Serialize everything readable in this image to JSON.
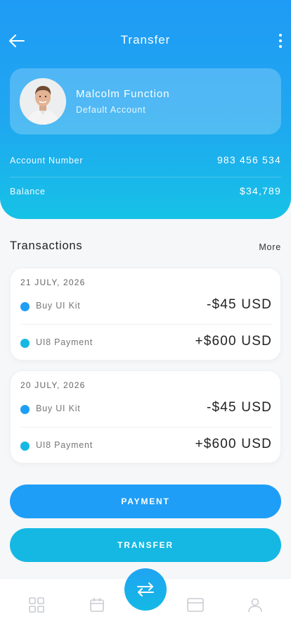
{
  "header": {
    "title": "Transfer",
    "back_icon": "arrow-left-icon",
    "menu_icon": "more-vertical-icon"
  },
  "account": {
    "name": "Malcolm Function",
    "type": "Default Account",
    "number_label": "Account Number",
    "number_value": "983 456 534",
    "balance_label": "Balance",
    "balance_value": "$34,789"
  },
  "transactions": {
    "title": "Transactions",
    "more_label": "More",
    "groups": [
      {
        "date": "21 JULY, 2026",
        "items": [
          {
            "name": "Buy UI Kit",
            "amount": "-$45 USD",
            "dot_color": "#1f9ef7"
          },
          {
            "name": "UI8 Payment",
            "amount": "+$600 USD",
            "dot_color": "#15b8e3"
          }
        ]
      },
      {
        "date": "20 JULY, 2026",
        "items": [
          {
            "name": "Buy UI Kit",
            "amount": "-$45 USD",
            "dot_color": "#1f9ef7"
          },
          {
            "name": "UI8 Payment",
            "amount": "+$600 USD",
            "dot_color": "#15b8e3"
          }
        ]
      }
    ]
  },
  "actions": {
    "payment_label": "PAYMENT",
    "transfer_label": "TRANSFER"
  },
  "bottom_nav": {
    "items": [
      "grid-icon",
      "calendar-icon",
      "transfer-arrows-icon",
      "card-icon",
      "user-icon"
    ],
    "active": "transfer-arrows-icon"
  },
  "colors": {
    "accent": "#1f9ef7",
    "accent_secondary": "#15b8e3",
    "nav_icon": "#c9ccd1"
  }
}
